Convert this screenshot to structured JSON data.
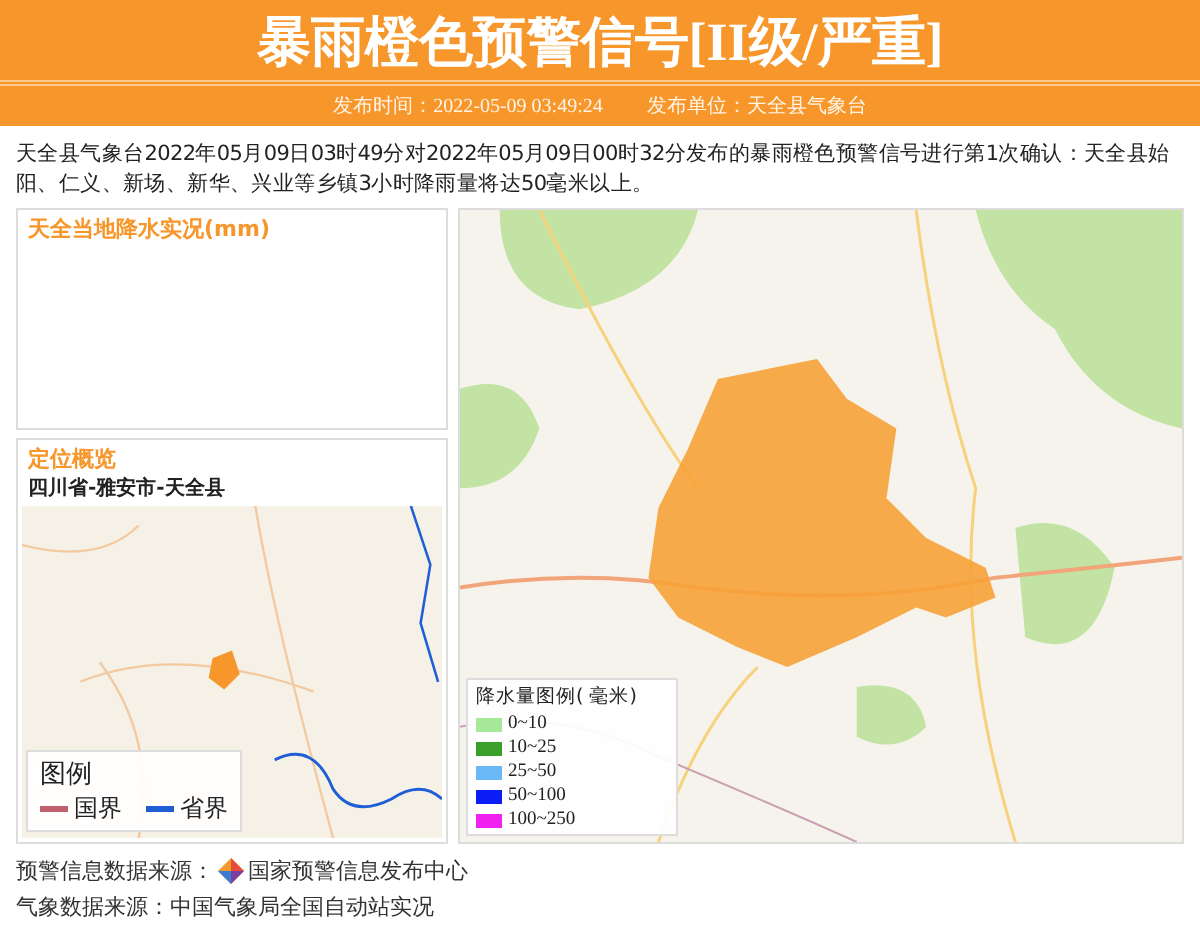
{
  "header": {
    "title": "暴雨橙色预警信号[II级/严重]",
    "time_label": "发布时间：2022-05-09 03:49:24",
    "issuer_label": "发布单位：天全县气象台"
  },
  "description": "天全县气象台2022年05月09日03时49分对2022年05月09日00时32分发布的暴雨橙色预警信号进行第1次确认：天全县始阳、仁义、新场、新华、兴业等乡镇3小时降雨量将达50毫米以上。",
  "rainfall_panel": {
    "title": "天全当地降水实况(mm)"
  },
  "location_panel": {
    "title": "定位概览",
    "region": "四川省-雅安市-天全县",
    "legend": {
      "title": "图例",
      "items": [
        {
          "label": "国界",
          "color": "#c0606e"
        },
        {
          "label": "省界",
          "color": "#1f5fd6"
        }
      ]
    }
  },
  "rain_legend": {
    "title": "降水量图例( 毫米)",
    "items": [
      {
        "label": "0~10",
        "color": "#a6e89a"
      },
      {
        "label": "10~25",
        "color": "#3aa02a"
      },
      {
        "label": "25~50",
        "color": "#6ab8f5"
      },
      {
        "label": "50~100",
        "color": "#0a1ef5"
      },
      {
        "label": "100~250",
        "color": "#f020f0"
      }
    ]
  },
  "footer": {
    "warning_source_label": "预警信息数据来源：",
    "warning_source": "国家预警信息发布中心",
    "weather_source": "气象数据来源：中国气象局全国自动站实况"
  }
}
